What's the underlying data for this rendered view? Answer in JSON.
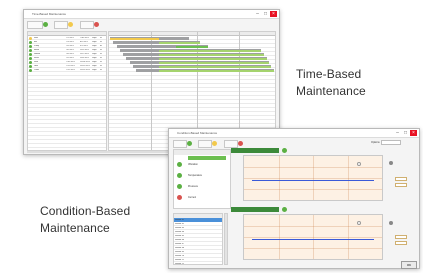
{
  "captions": {
    "time_based": [
      "Time-Based",
      "Maintenance"
    ],
    "condition_based": [
      "Condition-Based",
      "Maintenance"
    ]
  },
  "tbm_window": {
    "title": "Time-Based Maintenance",
    "rows": [
      {
        "status": "#f2c94c",
        "cells": [
          "Filter",
          "",
          "7/1 2021",
          "7/30 2021",
          "Days",
          "30"
        ]
      },
      {
        "status": "#5bb043",
        "cells": [
          "Belt",
          "",
          "7/3 2021",
          "8/5 2021",
          "Days",
          "30"
        ]
      },
      {
        "status": "#5bb043",
        "cells": [
          "Pump",
          "",
          "7/4 2021",
          "9/1 2021",
          "Days",
          "60"
        ]
      },
      {
        "status": "#5bb043",
        "cells": [
          "Motor",
          "",
          "7/6 2021",
          "10/1 2021",
          "Days",
          "90"
        ]
      },
      {
        "status": "#5bb043",
        "cells": [
          "Nozzle",
          "",
          "7/8 2021",
          "10/7 2021",
          "Days",
          "90"
        ]
      },
      {
        "status": "#5bb043",
        "cells": [
          "Valve",
          "",
          "7/9 2021",
          "10/9 2021",
          "Days",
          "90"
        ]
      },
      {
        "status": "#5bb043",
        "cells": [
          "Seal",
          "",
          "7/10 2021",
          "10/10 2021",
          "Days",
          "90"
        ]
      },
      {
        "status": "#5bb043",
        "cells": [
          "Gear",
          "",
          "7/11 2021",
          "10/11 2021",
          "Days",
          "90"
        ]
      },
      {
        "status": "#5bb043",
        "cells": [
          "Chain",
          "",
          "7/12 2021",
          "10/12 2021",
          "Days",
          "90"
        ]
      }
    ],
    "gantt": [
      {
        "color": "#9fa0a2",
        "start": 0.0,
        "end": 0.48
      },
      {
        "color": "#9fa0a2",
        "start": 0.02,
        "end": 0.55
      },
      {
        "color": "#9fa0a2",
        "start": 0.04,
        "end": 0.6
      },
      {
        "color": "#9fa0a2",
        "start": 0.06,
        "end": 0.92
      },
      {
        "color": "#9fa0a2",
        "start": 0.08,
        "end": 0.94
      },
      {
        "color": "#9fa0a2",
        "start": 0.1,
        "end": 0.96
      },
      {
        "color": "#9fa0a2",
        "start": 0.12,
        "end": 0.97
      },
      {
        "color": "#9fa0a2",
        "start": 0.14,
        "end": 0.98
      },
      {
        "color": "#9fa0a2",
        "start": 0.16,
        "end": 1.0
      }
    ],
    "gantt_progress": [
      {
        "color": "#f2c94c",
        "start": 0.0,
        "end": 0.3
      },
      {
        "color": "#a5d36e",
        "start": 0.3,
        "end": 0.55
      },
      {
        "color": "#6cbf50",
        "start": 0.4,
        "end": 0.6
      },
      {
        "color": "#a5d36e",
        "start": 0.3,
        "end": 0.92
      },
      {
        "color": "#a5d36e",
        "start": 0.3,
        "end": 0.94
      },
      {
        "color": "#a5d36e",
        "start": 0.3,
        "end": 0.96
      },
      {
        "color": "#a5d36e",
        "start": 0.3,
        "end": 0.97
      },
      {
        "color": "#a5d36e",
        "start": 0.3,
        "end": 0.98
      },
      {
        "color": "#a5d36e",
        "start": 0.3,
        "end": 1.0
      }
    ]
  },
  "cbm_window": {
    "title": "Condition-Based Maintenance",
    "options_label": "Options",
    "ok_label": "OK",
    "left_items": [
      {
        "color": "#5bb043",
        "label": "Vibration"
      },
      {
        "color": "#5bb043",
        "label": "Temperature"
      },
      {
        "color": "#5bb043",
        "label": "Pressure"
      },
      {
        "color": "#d9534f",
        "label": "Current"
      }
    ],
    "list_rows": [
      "Sensor 01",
      "Sensor 02",
      "Sensor 03",
      "Sensor 04",
      "Sensor 05",
      "Sensor 06",
      "Sensor 07",
      "Sensor 08",
      "Sensor 09",
      "Sensor 10",
      "Sensor 11",
      "Sensor 12"
    ],
    "charts": [
      {
        "name": "Chart 1",
        "line_level": 0.45
      },
      {
        "name": "Chart 2",
        "line_level": 0.45
      }
    ]
  }
}
